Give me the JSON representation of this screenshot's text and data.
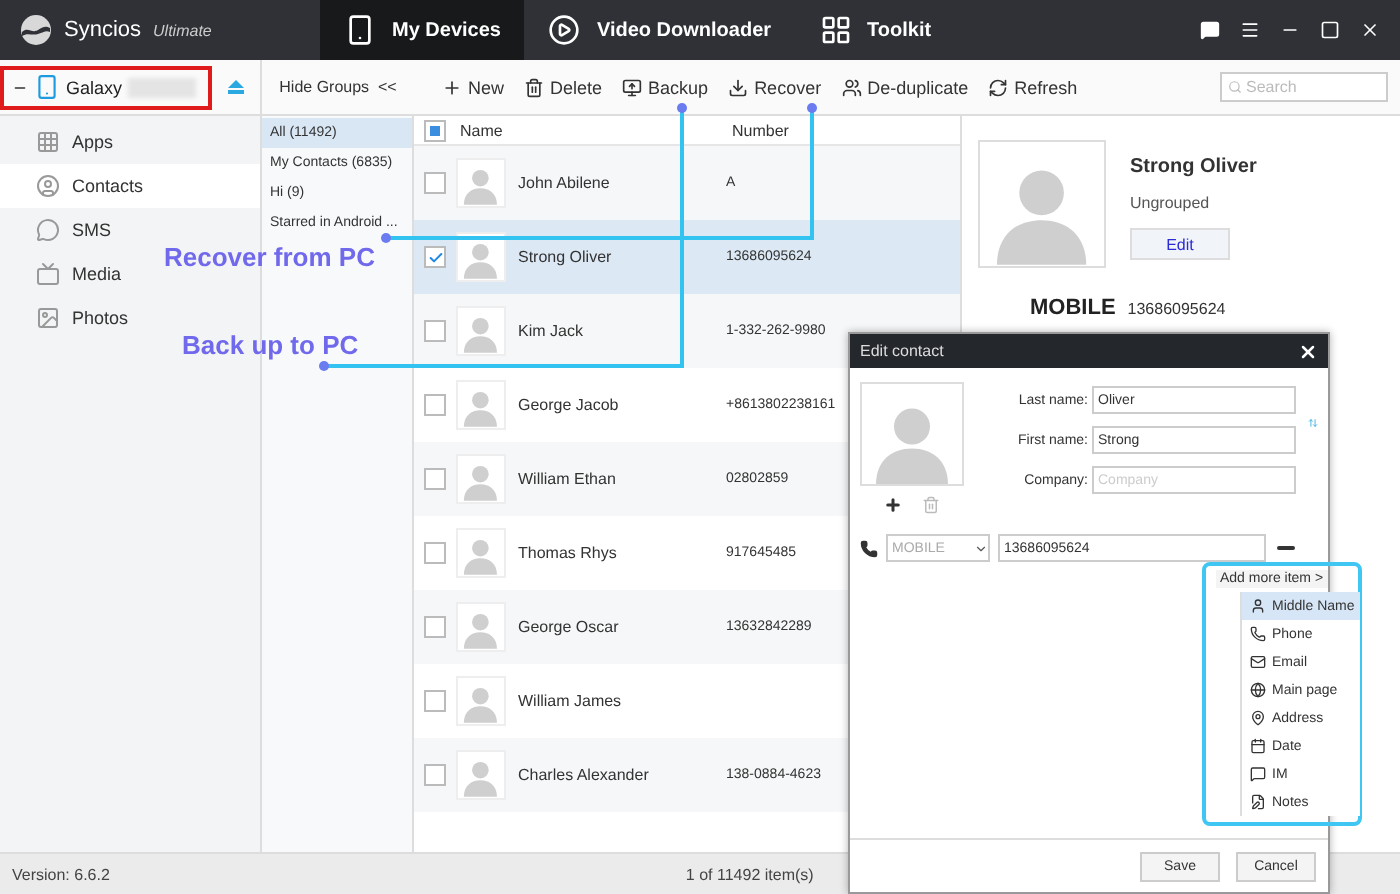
{
  "app": {
    "name": "Syncios",
    "edition": "Ultimate"
  },
  "nav_tabs": [
    {
      "label": "My Devices",
      "selected": true
    },
    {
      "label": "Video Downloader",
      "selected": false
    },
    {
      "label": "Toolkit",
      "selected": false
    }
  ],
  "device": {
    "name": "Galaxy",
    "highlighted": true
  },
  "hide_groups": "Hide Groups  <<",
  "toolbar": [
    "New",
    "Delete",
    "Backup",
    "Recover",
    "De-duplicate",
    "Refresh"
  ],
  "search": {
    "placeholder": "Search"
  },
  "sidebar": [
    {
      "label": "Apps",
      "selected": false
    },
    {
      "label": "Contacts",
      "selected": true
    },
    {
      "label": "SMS",
      "selected": false
    },
    {
      "label": "Media",
      "selected": false
    },
    {
      "label": "Photos",
      "selected": false
    }
  ],
  "groups": [
    {
      "label": "All (11492)",
      "selected": true
    },
    {
      "label": "My Contacts (6835)",
      "selected": false
    },
    {
      "label": "Hi (9)",
      "selected": false
    },
    {
      "label": "Starred in Android ...",
      "selected": false
    }
  ],
  "table": {
    "header_partial": true,
    "columns": [
      "Name",
      "Number"
    ],
    "rows": [
      {
        "name": "John Abilene",
        "number": "A",
        "checked": false,
        "selected": false
      },
      {
        "name": "Strong Oliver",
        "number": "13686095624",
        "checked": true,
        "selected": true
      },
      {
        "name": "Kim Jack",
        "number": "1-332-262-9980",
        "checked": false,
        "selected": false
      },
      {
        "name": "George Jacob",
        "number": "+8613802238161",
        "checked": false,
        "selected": false
      },
      {
        "name": "William Ethan",
        "number": "02802859",
        "checked": false,
        "selected": false
      },
      {
        "name": "Thomas Rhys",
        "number": "917645485",
        "checked": false,
        "selected": false
      },
      {
        "name": "George Oscar",
        "number": "13632842289",
        "checked": false,
        "selected": false
      },
      {
        "name": "William James",
        "checked": false,
        "selected": false
      },
      {
        "name": "Charles Alexander",
        "number": "138-0884-4623",
        "checked": false,
        "selected": false
      }
    ]
  },
  "detail": {
    "name": "Strong Oliver",
    "group": "Ungrouped",
    "edit_button": "Edit",
    "phone_label": "MOBILE",
    "phone": "13686095624"
  },
  "dialog": {
    "title": "Edit contact",
    "fields": [
      {
        "label": "Last name:",
        "value": "Oliver"
      },
      {
        "label": "First name:",
        "value": "Strong"
      },
      {
        "label": "Company:",
        "placeholder": "Company"
      }
    ],
    "phone": {
      "type": "MOBILE",
      "number": "13686095624"
    },
    "add_more": "Add more item >",
    "menu": [
      {
        "label": "Middle Name",
        "selected": true
      },
      {
        "label": "Phone",
        "selected": false
      },
      {
        "label": "Email",
        "selected": false
      },
      {
        "label": "Main page",
        "selected": false
      },
      {
        "label": "Address",
        "selected": false
      },
      {
        "label": "Date",
        "selected": false
      },
      {
        "label": "IM",
        "selected": false
      },
      {
        "label": "Notes",
        "selected": false
      }
    ],
    "buttons": [
      "Save",
      "Cancel"
    ]
  },
  "annotations": [
    {
      "text": "Recover from PC"
    },
    {
      "text": "Back up to PC"
    }
  ],
  "status_bar": {
    "version": "Version: 6.6.2",
    "count": "1 of 11492 item(s)"
  }
}
